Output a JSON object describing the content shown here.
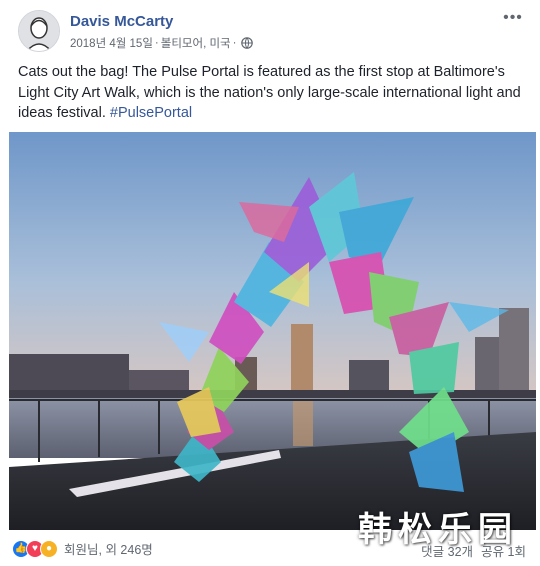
{
  "post": {
    "author_name": "Davis McCarty",
    "timestamp": "2018년 4월 15일",
    "location": "볼티모어, 미국",
    "separator": " · ",
    "privacy_icon": "globe-icon",
    "more_icon": "ellipsis-icon",
    "text": "Cats out the bag! The Pulse Portal is featured as the first stop at Baltimore's Light City Art Walk, which is the nation's only large-scale international light and ideas festival.",
    "hashtag": "#PulsePortal"
  },
  "footer": {
    "reaction_icons": [
      "like-icon",
      "love-icon",
      "wow-icon"
    ],
    "reaction_summary": "회원님, 외 246명",
    "comments": "댓글 32개",
    "shares": "공유 1회"
  },
  "watermark": {
    "text": "韩松乐园"
  },
  "colors": {
    "link": "#365899",
    "meta": "#606770",
    "text": "#1d2129",
    "like": "#1877f2",
    "love": "#f33e58",
    "wow": "#f7b125"
  }
}
